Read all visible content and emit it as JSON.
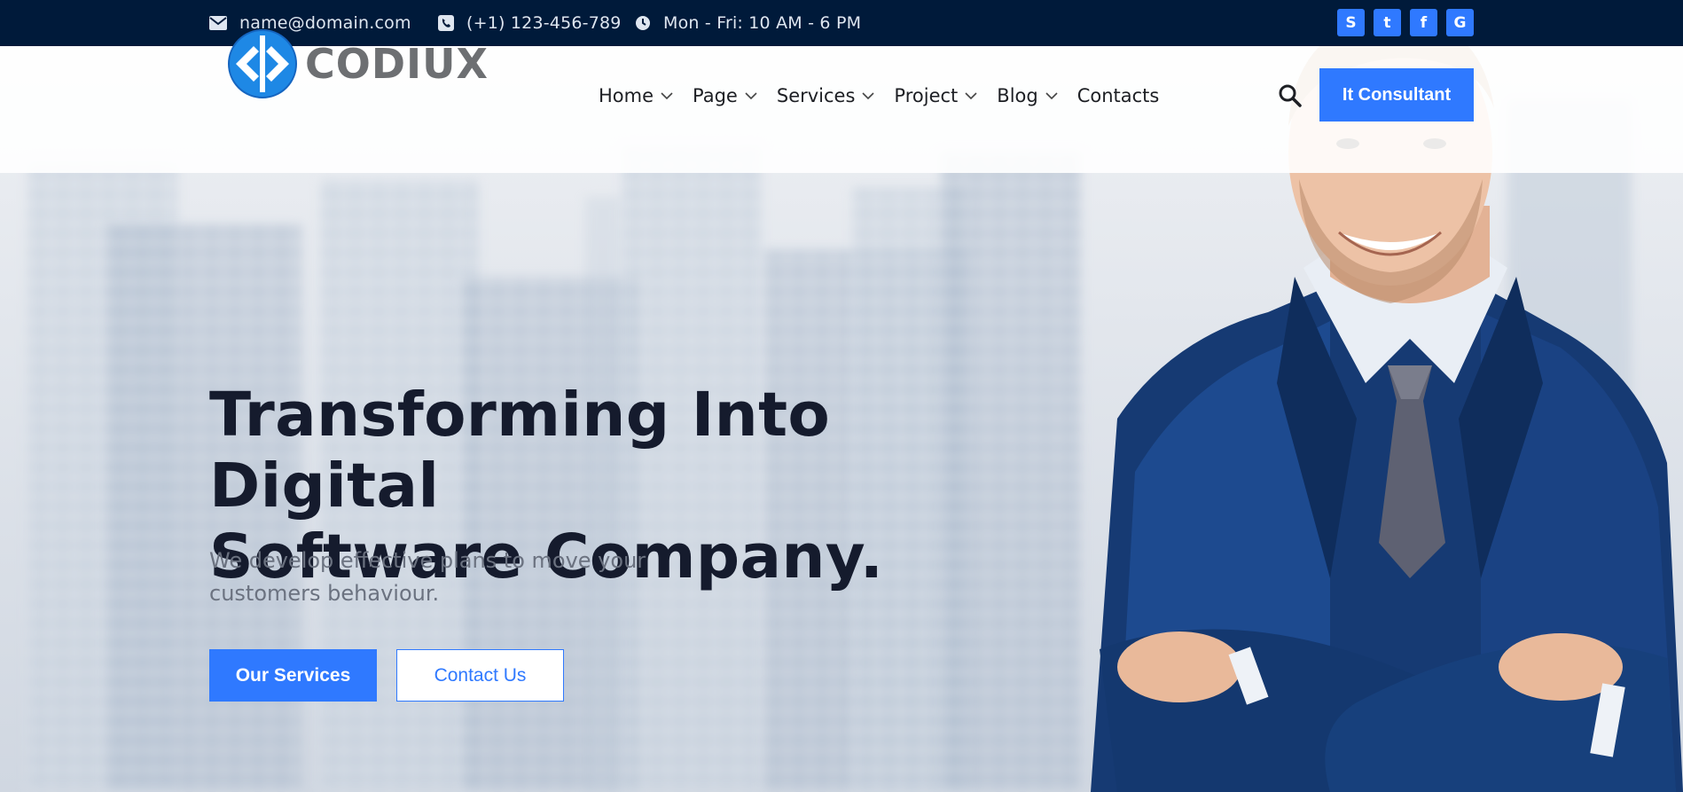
{
  "topbar": {
    "email": "name@domain.com",
    "phone": "(+1) 123-456-789",
    "hours": "Mon - Fri: 10 AM - 6 PM",
    "social": [
      {
        "icon": "skype-icon",
        "glyph": "S"
      },
      {
        "icon": "twitter-icon",
        "glyph": "t"
      },
      {
        "icon": "facebook-icon",
        "glyph": "f"
      },
      {
        "icon": "google-icon",
        "glyph": "G"
      }
    ]
  },
  "header": {
    "logo_text": "CODIUX",
    "nav": [
      {
        "label": "Home",
        "has_dropdown": true
      },
      {
        "label": "Page",
        "has_dropdown": true
      },
      {
        "label": "Services",
        "has_dropdown": true
      },
      {
        "label": "Project",
        "has_dropdown": true
      },
      {
        "label": "Blog",
        "has_dropdown": true
      },
      {
        "label": "Contacts",
        "has_dropdown": false
      }
    ],
    "cta_label": "It Consultant"
  },
  "hero": {
    "title_line1": "Transforming Into Digital",
    "title_line2": "Software Company.",
    "subtitle_line1": "We develop effective plans to move your",
    "subtitle_line2": "customers behaviour.",
    "primary_button": "Our Services",
    "secondary_button": "Contact Us"
  },
  "colors": {
    "topbar_bg": "#001a3a",
    "accent": "#2f79ff",
    "heading": "#151b2d"
  }
}
